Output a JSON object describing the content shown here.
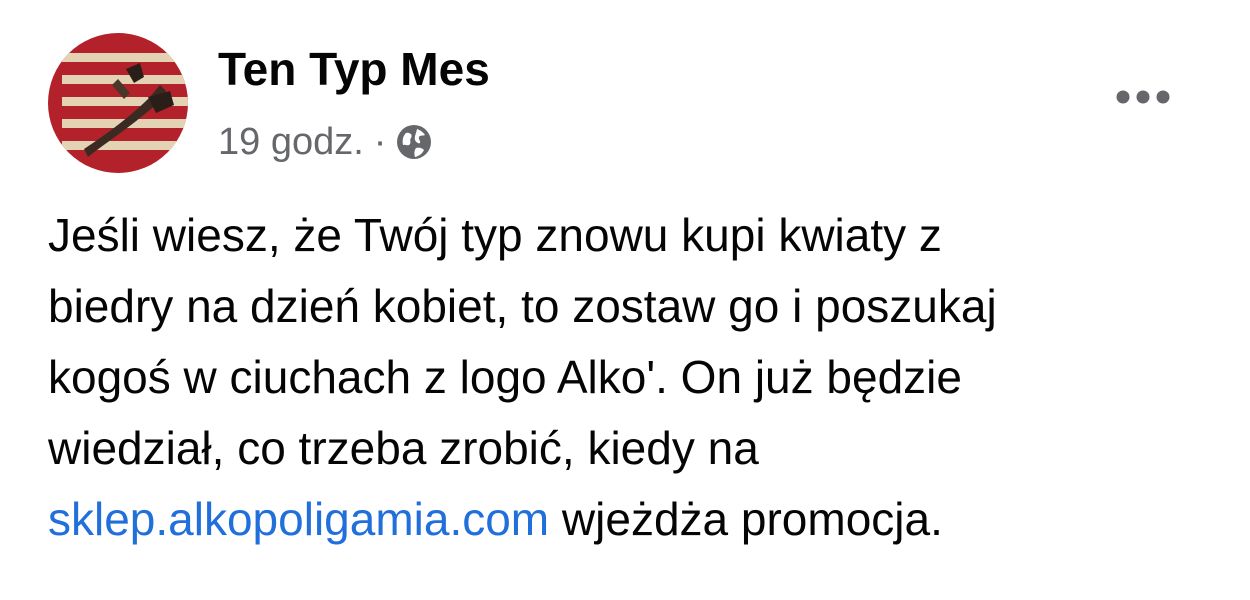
{
  "post": {
    "author": "Ten Typ Mes",
    "timestamp": "19 godz.",
    "separator": "·",
    "privacy_icon": "globe-icon",
    "menu_icon": "more-dots-icon",
    "text_lines": [
      "Jeśli wiesz, że Twój typ znowu kupi kwiaty z",
      "biedry na dzień kobiet, to zostaw go i poszukaj",
      "kogoś w ciuchach z logo Alko'. On już będzie",
      "wiedział, co trzeba zrobić, kiedy na"
    ],
    "link_text": "sklep.alkopoligamia.com",
    "text_after_link": " wjeżdża promocja."
  },
  "colors": {
    "text": "#050505",
    "secondary_text": "#65676b",
    "link": "#216fdb",
    "avatar_red": "#b3222a",
    "avatar_stripe": "#e3d3b4"
  }
}
